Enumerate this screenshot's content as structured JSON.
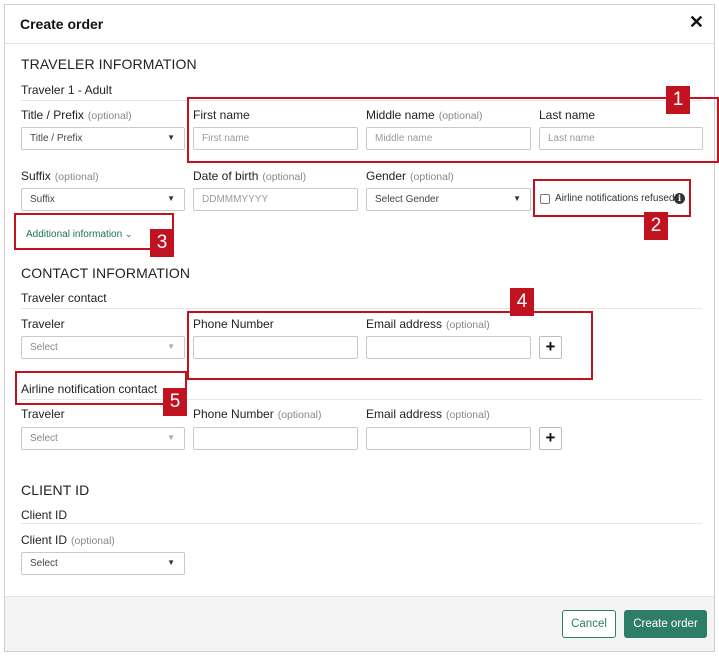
{
  "dialog": {
    "title": "Create order",
    "close_icon": "close-icon"
  },
  "traveler_info": {
    "section_title": "TRAVELER INFORMATION",
    "subheading": "Traveler 1 - Adult",
    "title_prefix": {
      "label": "Title / Prefix",
      "optional": "(optional)",
      "value": "Title / Prefix"
    },
    "first_name": {
      "label": "First name",
      "placeholder": "First name"
    },
    "middle_name": {
      "label": "Middle name",
      "optional": "(optional)",
      "placeholder": "Middle name"
    },
    "last_name": {
      "label": "Last name",
      "placeholder": "Last name"
    },
    "suffix": {
      "label": "Suffix",
      "optional": "(optional)",
      "value": "Suffix"
    },
    "dob": {
      "label": "Date of birth",
      "optional": "(optional)",
      "placeholder": "DDMMMYYYY"
    },
    "gender": {
      "label": "Gender",
      "optional": "(optional)",
      "value": "Select Gender"
    },
    "airline_notifications_refused": {
      "label": "Airline notifications refused",
      "checked": false
    },
    "additional_info_link": "Additional information"
  },
  "contact_info": {
    "section_title": "CONTACT INFORMATION",
    "traveler_contact": {
      "subheading": "Traveler contact",
      "traveler": {
        "label": "Traveler",
        "value": "Select"
      },
      "phone": {
        "label": "Phone Number"
      },
      "email": {
        "label": "Email address",
        "optional": "(optional)"
      },
      "add_label": "+"
    },
    "airline_notification_contact": {
      "subheading": "Airline notification contact",
      "traveler": {
        "label": "Traveler",
        "value": "Select"
      },
      "phone": {
        "label": "Phone Number",
        "optional": "(optional)"
      },
      "email": {
        "label": "Email address",
        "optional": "(optional)"
      },
      "add_label": "+"
    }
  },
  "client_id": {
    "section_title": "CLIENT ID",
    "subheading": "Client ID",
    "field": {
      "label": "Client ID",
      "optional": "(optional)",
      "value": "Select"
    }
  },
  "footer": {
    "cancel_label": "Cancel",
    "create_label": "Create order"
  },
  "annotations": [
    "1",
    "2",
    "3",
    "4",
    "5"
  ],
  "colors": {
    "accent": "#2e7d66",
    "annotation": "#c1121f"
  }
}
